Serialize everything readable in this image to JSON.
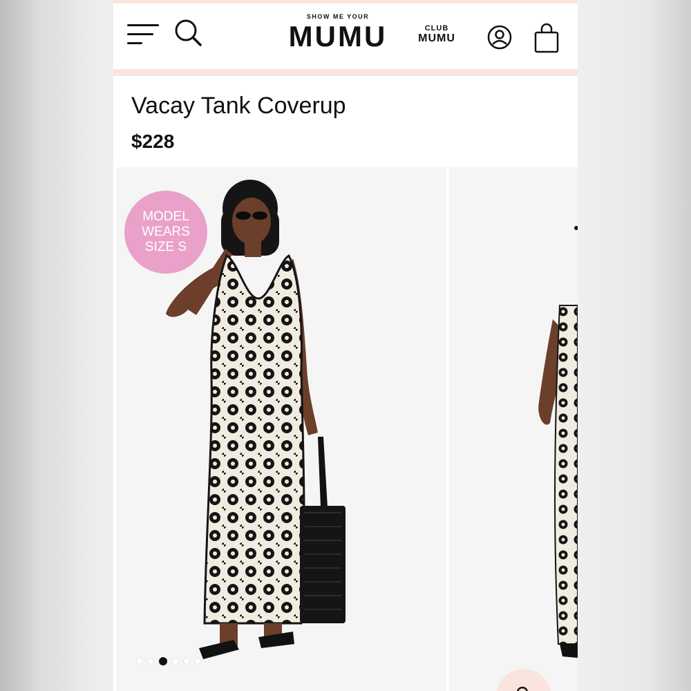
{
  "header": {
    "logo_small": "SHOW ME YOUR",
    "logo_big": "MUMU",
    "club_line1": "CLUB",
    "club_line2": "MUMU",
    "icons": [
      "menu-icon",
      "search-icon",
      "account-icon",
      "shopping-bag-icon"
    ]
  },
  "product": {
    "title": "Vacay Tank Coverup",
    "price": "$228"
  },
  "gallery": {
    "badge_line1": "MODEL",
    "badge_line2": "WEARS",
    "badge_line3": "SIZE S",
    "slide_count": 6,
    "active_slide": 3
  },
  "colors": {
    "accent_pink": "#eaa1c9",
    "header_border": "#fbe4dd",
    "text": "#111111"
  }
}
